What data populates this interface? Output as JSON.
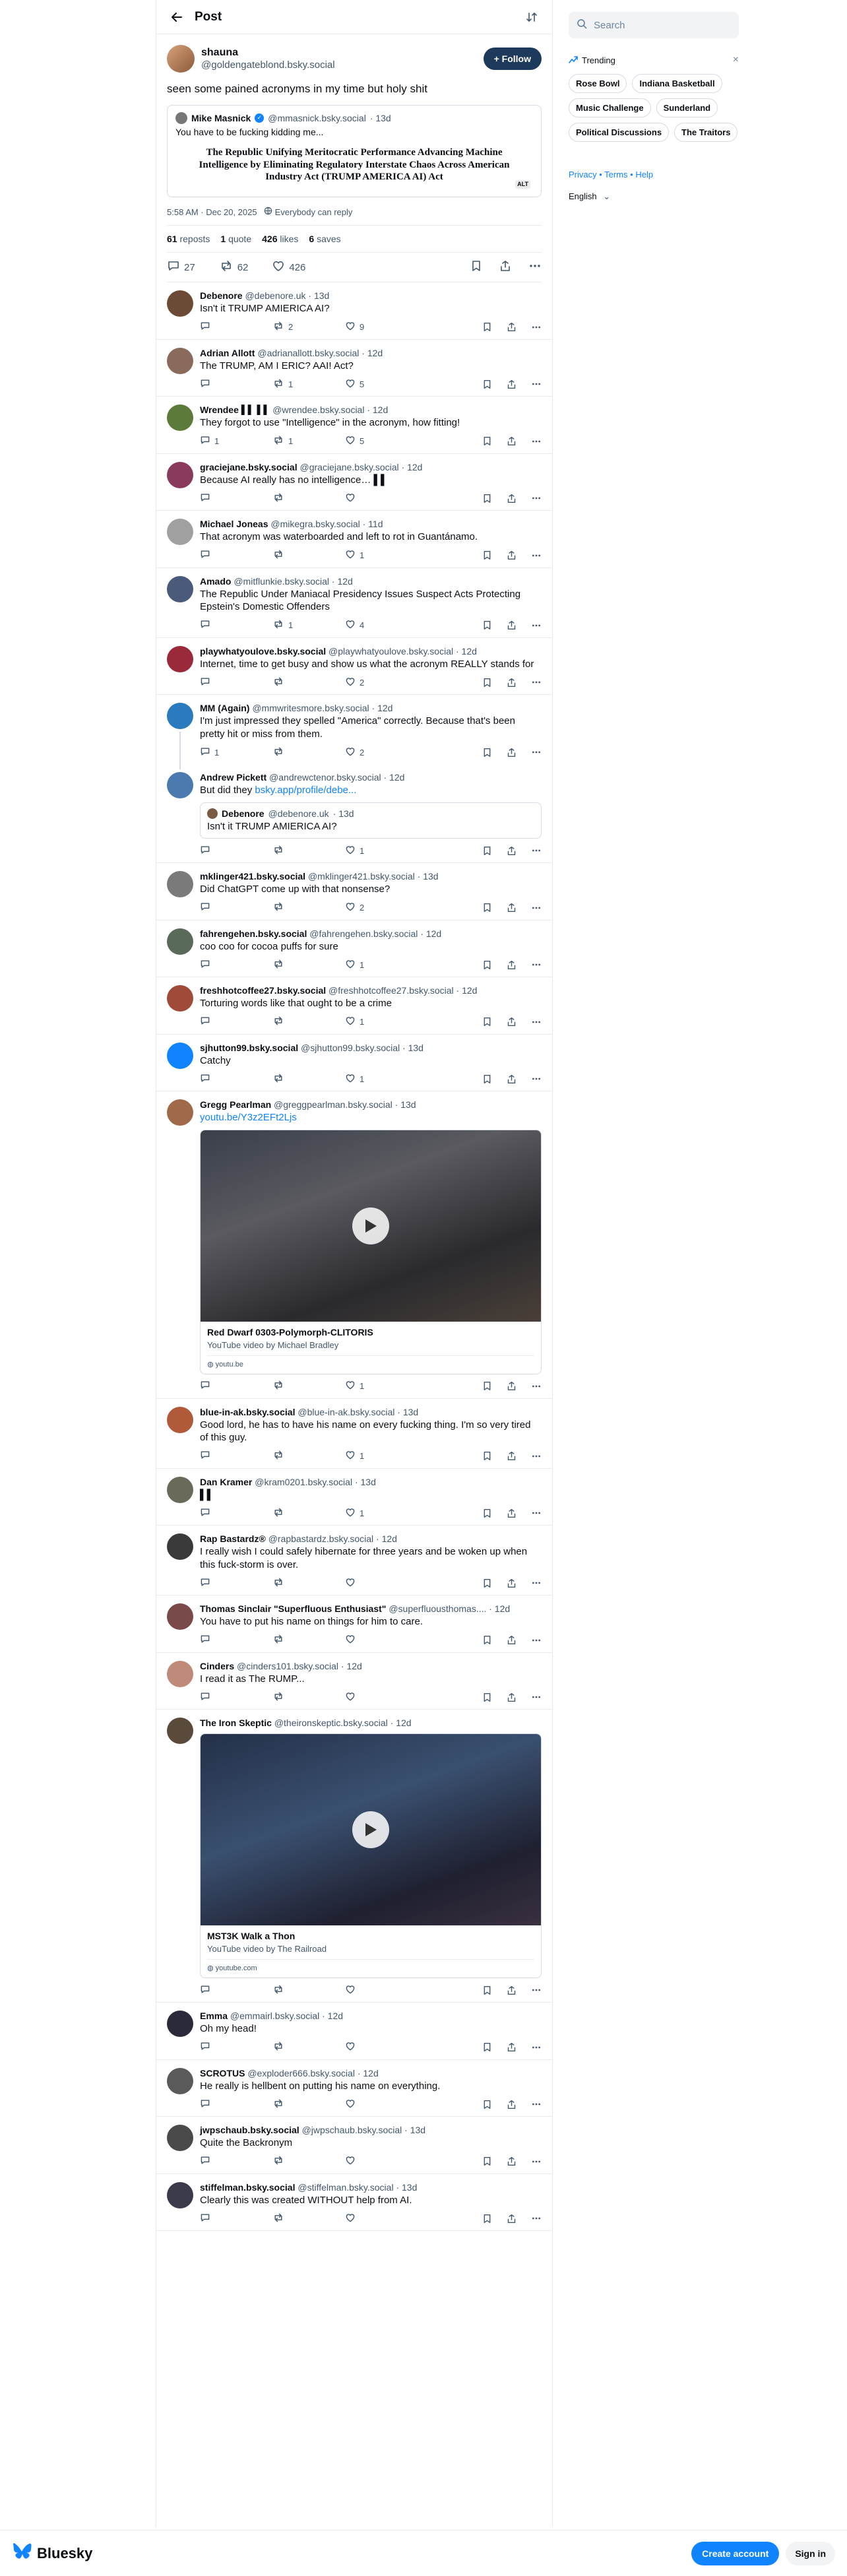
{
  "header": {
    "title": "Post"
  },
  "op": {
    "display_name": "shauna",
    "handle": "@goldengateblond.bsky.social",
    "follow_label": "+ Follow",
    "text": "seen some pained acronyms in my time but holy shit",
    "quote": {
      "display_name": "Mike Masnick",
      "handle": "@mmasnick.bsky.social",
      "time": "· 13d",
      "text": "You have to be fucking kidding me...",
      "image_text": "The Republic Unifying Meritocratic Performance Advancing Machine Intelligence by Eliminating Regulatory Interstate Chaos Across American Industry Act (TRUMP AMERICA AI) Act",
      "alt_badge": "ALT"
    },
    "timestamp": "5:58 AM · Dec 20, 2025",
    "reply_setting": "Everybody can reply",
    "stats": {
      "reposts_count": "61",
      "reposts_label": "reposts",
      "quotes_count": "1",
      "quotes_label": "quote",
      "likes_count": "426",
      "likes_label": "likes",
      "saves_count": "6",
      "saves_label": "saves"
    },
    "actions": {
      "replies": "27",
      "reposts": "62",
      "likes": "426"
    }
  },
  "replies": [
    {
      "name": "Debenore",
      "handle": "@debenore.uk",
      "time": "· 13d",
      "text": "Isn't it TRUMP AMIERICA AI?",
      "r": "",
      "rp": "2",
      "l": "9",
      "color": "#6b4a36"
    },
    {
      "name": "Adrian Allott",
      "handle": "@adrianallott.bsky.social",
      "time": "· 12d",
      "text": "The TRUMP, AM I ERIC? AAI! Act?",
      "r": "",
      "rp": "1",
      "l": "5",
      "color": "#8a6a5a"
    },
    {
      "name": "Wrendee ▌▌ ▌▌",
      "handle": "@wrendee.bsky.social",
      "time": "· 12d",
      "text": "They forgot to use \"Intelligence\" in the acronym, how fitting!",
      "r": "1",
      "rp": "1",
      "l": "5",
      "color": "#5c7a3a"
    },
    {
      "name": "graciejane.bsky.social",
      "handle": "@graciejane.bsky.social",
      "time": "· 12d",
      "text": "Because AI really has no intelligence… ▌▌",
      "r": "",
      "rp": "",
      "l": "",
      "color": "#8a3a5c"
    },
    {
      "name": "Michael Joneas",
      "handle": "@mikegra.bsky.social",
      "time": "· 11d",
      "text": "That acronym was waterboarded and left to rot in Guantánamo.",
      "r": "",
      "rp": "",
      "l": "1",
      "color": "#a0a0a0"
    },
    {
      "name": "Amado",
      "handle": "@mitflunkie.bsky.social",
      "time": "· 12d",
      "text": "The Republic Under Maniacal Presidency Issues Suspect Acts Protecting Epstein's Domestic Offenders",
      "r": "",
      "rp": "1",
      "l": "4",
      "color": "#4a5a7a"
    },
    {
      "name": "playwhatyoulove.bsky.social",
      "handle": "@playwhatyoulove.bsky.social",
      "time": "· 12d",
      "text": "Internet, time to get busy and show us what the acronym REALLY stands for",
      "r": "",
      "rp": "",
      "l": "2",
      "color": "#9a2a3a"
    },
    {
      "name": "MM (Again)",
      "handle": "@mmwritesmore.bsky.social",
      "time": "· 12d",
      "text": "I'm just impressed they spelled \"America\" correctly. Because that's been pretty hit or miss from them.",
      "r": "1",
      "rp": "",
      "l": "2",
      "color": "#2a7ac0"
    },
    {
      "name": "Andrew Pickett",
      "handle": "@andrewctenor.bsky.social",
      "time": "· 12d",
      "text": "But did they ",
      "link": "bsky.app/profile/debe...",
      "quote_name": "Debenore",
      "quote_handle": "@debenore.uk",
      "quote_time": "· 13d",
      "quote_text": "Isn't it TRUMP AMIERICA AI?",
      "r": "",
      "rp": "",
      "l": "1",
      "color": "#4a7ab0"
    },
    {
      "name": "mklinger421.bsky.social",
      "handle": "@mklinger421.bsky.social",
      "time": "· 13d",
      "text": "Did ChatGPT come up with that nonsense?",
      "r": "",
      "rp": "",
      "l": "2",
      "color": "#7a7a7a"
    },
    {
      "name": "fahrengehen.bsky.social",
      "handle": "@fahrengehen.bsky.social",
      "time": "· 12d",
      "text": "coo coo for cocoa puffs for sure",
      "r": "",
      "rp": "",
      "l": "1",
      "color": "#5a6a5a"
    },
    {
      "name": "freshhotcoffee27.bsky.social",
      "handle": "@freshhotcoffee27.bsky.social",
      "time": "· 12d",
      "text": "Torturing words like that ought to be a crime",
      "r": "",
      "rp": "",
      "l": "1",
      "color": "#a04a3a"
    },
    {
      "name": "sjhutton99.bsky.social",
      "handle": "@sjhutton99.bsky.social",
      "time": "· 13d",
      "text": "Catchy",
      "r": "",
      "rp": "",
      "l": "1",
      "color": "#1083fe"
    },
    {
      "name": "Gregg Pearlman",
      "handle": "@greggpearlman.bsky.social",
      "time": "· 13d",
      "link_only": "youtu.be/Y3z2EFt2Ljs",
      "embed_title": "Red Dwarf 0303-Polymorph-CLITORIS",
      "embed_desc": "YouTube video by Michael Bradley",
      "embed_url": "youtu.be",
      "r": "",
      "rp": "",
      "l": "1",
      "color": "#a06a4a"
    },
    {
      "name": "blue-in-ak.bsky.social",
      "handle": "@blue-in-ak.bsky.social",
      "time": "· 13d",
      "text": "Good lord, he has to have his name on every fucking thing.  I'm so very tired of this guy.",
      "r": "",
      "rp": "",
      "l": "1",
      "color": "#b05a3a"
    },
    {
      "name": "Dan Kramer",
      "handle": "@kram0201.bsky.social",
      "time": "· 13d",
      "text": "▌▌",
      "r": "",
      "rp": "",
      "l": "1",
      "color": "#6a6a5a"
    },
    {
      "name": "Rap Bastardz®",
      "handle": "@rapbastardz.bsky.social",
      "time": "· 12d",
      "text": "I really wish I could safely hibernate for three years and be woken up when this fuck-storm is over.",
      "r": "",
      "rp": "",
      "l": "",
      "color": "#3a3a3a"
    },
    {
      "name": "Thomas Sinclair \"Superfluous Enthusiast\"",
      "handle": "@superfluousthomas....",
      "time": "· 12d",
      "text": "You have to put his name on things for him to care.",
      "r": "",
      "rp": "",
      "l": "",
      "color": "#7a4a4a"
    },
    {
      "name": "Cinders",
      "handle": "@cinders101.bsky.social",
      "time": "· 12d",
      "text": "I read it as The RUMP...",
      "r": "",
      "rp": "",
      "l": "",
      "color": "#c08a7a"
    },
    {
      "name": "The Iron Skeptic",
      "handle": "@theironskeptic.bsky.social",
      "time": "· 12d",
      "embed_title": "MST3K Walk a Thon",
      "embed_desc": "YouTube video by The Railroad",
      "embed_url": "youtube.com",
      "r": "",
      "rp": "",
      "l": "",
      "color": "#5a4a3a"
    },
    {
      "name": "Emma",
      "handle": "@emmairl.bsky.social",
      "time": "· 12d",
      "text": "Oh my head!",
      "r": "",
      "rp": "",
      "l": "",
      "color": "#2a2a3a"
    },
    {
      "name": "SCROTUS",
      "handle": "@exploder666.bsky.social",
      "time": "· 12d",
      "text": "He really is hellbent on putting his name on everything.",
      "r": "",
      "rp": "",
      "l": "",
      "color": "#5a5a5a"
    },
    {
      "name": "jwpschaub.bsky.social",
      "handle": "@jwpschaub.bsky.social",
      "time": "· 13d",
      "text": "Quite the Backronym",
      "r": "",
      "rp": "",
      "l": "",
      "color": "#4a4a4a"
    },
    {
      "name": "stiffelman.bsky.social",
      "handle": "@stiffelman.bsky.social",
      "time": "· 13d",
      "text": "Clearly this was created WITHOUT help from AI.",
      "r": "",
      "rp": "",
      "l": "",
      "color": "#3a3a4a"
    }
  ],
  "sidebar": {
    "search_placeholder": "Search",
    "trending_label": "Trending",
    "trending": [
      "Rose Bowl",
      "Indiana Basketball",
      "Music Challenge",
      "Sunderland",
      "Political Discussions",
      "The Traitors"
    ],
    "links": "Privacy • Terms • Help",
    "language": "English"
  },
  "footer": {
    "brand": "Bluesky",
    "create_account": "Create account",
    "sign_in": "Sign in"
  },
  "colors": {
    "accent": "#1083fe",
    "follow_bg": "#1d3a5c",
    "muted": "#42576c"
  }
}
